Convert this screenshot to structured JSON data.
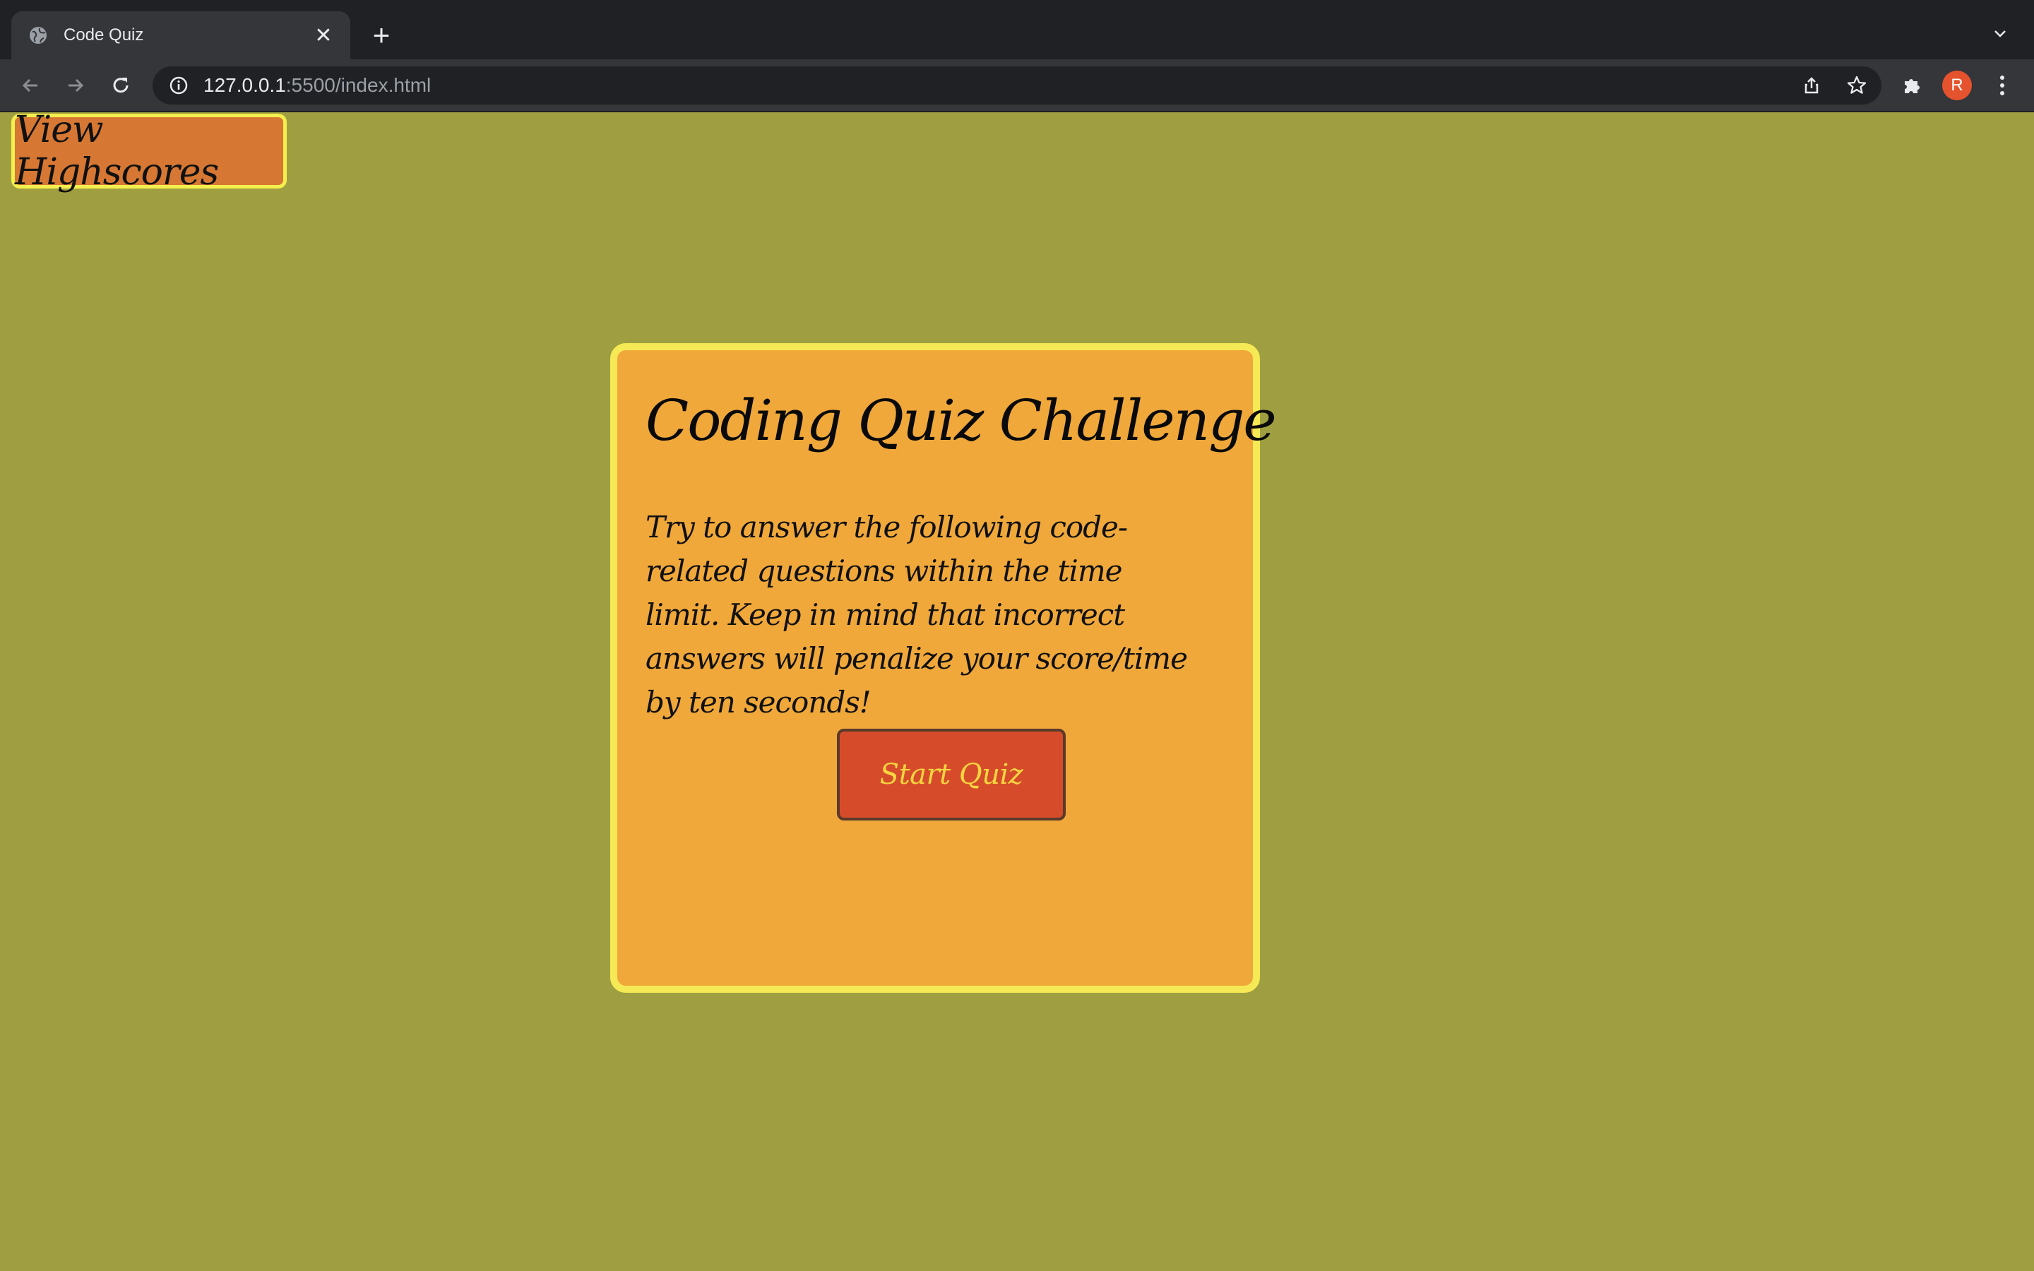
{
  "browser": {
    "tab_title": "Code Quiz",
    "url_host": "127.0.0.1",
    "url_rest": ":5500/index.html",
    "profile_initial": "R",
    "profile_color": "#e4532d"
  },
  "page": {
    "highscores_label": "View Highscores",
    "title": "Coding Quiz Challenge",
    "description": "Try to answer the following code-related questions within the time limit. Keep in mind that incorrect answers will penalize your score/time by ten seconds!",
    "start_label": "Start Quiz",
    "colors": {
      "background": "#9f9f41",
      "card": "#f0a83b",
      "card_border": "#f5ea55",
      "highscores_button": "#d67834",
      "start_button": "#d64c2a",
      "start_text": "#f5d540"
    }
  }
}
